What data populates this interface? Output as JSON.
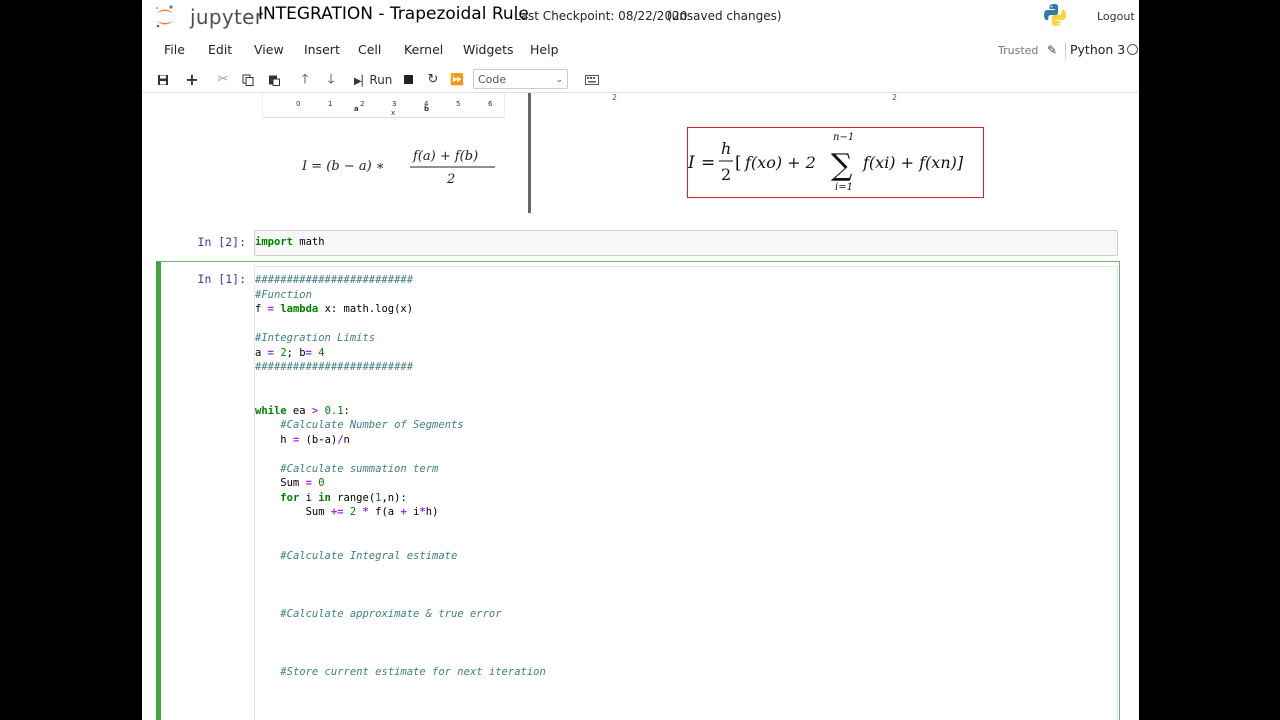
{
  "header": {
    "logo_text": "jupyter",
    "notebook_title": "INTEGRATION - Trapezoidal Rule",
    "checkpoint": "Last Checkpoint: 08/22/2020",
    "unsaved": "(unsaved changes)",
    "logout_label": "Logout"
  },
  "menu": {
    "items": [
      "File",
      "Edit",
      "View",
      "Insert",
      "Cell",
      "Kernel",
      "Widgets",
      "Help"
    ],
    "trusted": "Trusted",
    "kernel": "Python 3"
  },
  "toolbar": {
    "run_label": "Run",
    "cell_type": "Code",
    "icons": [
      "save-icon",
      "plus-icon",
      "cut-icon",
      "copy-icon",
      "paste-icon",
      "arrow-up-icon",
      "arrow-down-icon",
      "run-icon",
      "stop-icon",
      "restart-icon",
      "fast-forward-icon",
      "keyboard-icon"
    ]
  },
  "markdown": {
    "axis_ticks": [
      "0",
      "1",
      "2",
      "3",
      "4",
      "5",
      "6"
    ],
    "axis_labels": [
      "a",
      "x",
      "b"
    ],
    "formula_simple": "I = (b − a) ∗ (f(a) + f(b)) / 2",
    "formula_composite": "I = h/2 [ f(xo) + 2 Σ_{i=1}^{n−1} f(xi) + f(xn)]"
  },
  "cells": [
    {
      "prompt": "In [2]:",
      "lines": [
        "import math"
      ]
    },
    {
      "prompt": "In [1]:",
      "lines": [
        "#########################",
        "#Function",
        "f = lambda x: math.log(x)",
        "",
        "#Integration Limits",
        "a = 2; b= 4",
        "#########################",
        "",
        "",
        "while ea > 0.1:",
        "    #Calculate Number of Segments",
        "    h = (b-a)/n",
        "",
        "    #Calculate summation term",
        "    Sum = 0",
        "    for i in range(1,n):",
        "        Sum += 2 * f(a + i*h)",
        "",
        "",
        "    #Calculate Integral estimate",
        "",
        "",
        "",
        "    #Calculate approximate & true error",
        "",
        "",
        "",
        "    #Store current estimate for next iteration"
      ]
    }
  ]
}
